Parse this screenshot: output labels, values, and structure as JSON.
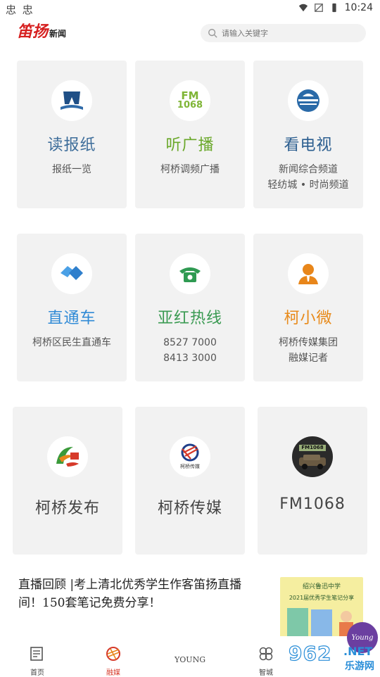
{
  "status_bar": {
    "left_icons": "忠 忠",
    "time": "10:24"
  },
  "header": {
    "logo_main": "笛扬",
    "logo_sub": "新闻",
    "search_placeholder": "请输入关键字"
  },
  "cards": [
    {
      "title": "读报纸",
      "desc": [
        "报纸一览"
      ],
      "title_color": "#3d6d9a",
      "icon": "newspaper-icon"
    },
    {
      "title": "听广播",
      "desc": [
        "柯桥调频广播"
      ],
      "title_color": "#6aa82a",
      "icon": "fm-radio-icon",
      "icon_text": [
        "FM",
        "1068"
      ]
    },
    {
      "title": "看电视",
      "desc": [
        "新闻综合频道",
        "轻纺城 • 时尚频道"
      ],
      "title_color": "#2a5d8f",
      "icon": "tv-station-icon"
    },
    {
      "title": "直通车",
      "desc": [
        "柯桥区民生直通车"
      ],
      "title_color": "#2f8ad6",
      "icon": "handshake-icon"
    },
    {
      "title": "亚红热线",
      "desc": [
        "8527 7000",
        "8413 3000"
      ],
      "title_color": "#3a9a52",
      "icon": "phone-icon"
    },
    {
      "title": "柯小微",
      "desc": [
        "柯桥传媒集团",
        "融媒记者"
      ],
      "title_color": "#e88a1a",
      "icon": "reporter-icon"
    }
  ],
  "media_cards": [
    {
      "title": "柯桥发布",
      "icon": "keqiao-release-logo-icon"
    },
    {
      "title": "柯桥传媒",
      "icon": "keqiao-media-logo-icon",
      "logo_caption": "柯桥传媒"
    },
    {
      "title": "FM1068",
      "icon": "fm1068-car-icon",
      "badge": "FM1068"
    }
  ],
  "news": {
    "headline": "直播回顾 |考上清北优秀学生作客笛扬直播间！150套笔记免费分享！",
    "thumb_line1": "绍兴鲁迅中学",
    "thumb_line2": "2021届优秀学生笔记分享"
  },
  "tabs": [
    {
      "label": "首页",
      "icon": "home-doc-icon"
    },
    {
      "label": "融媒",
      "icon": "media-fusion-icon",
      "active": true
    },
    {
      "label": "YOUNG",
      "icon": "young-icon",
      "badge": "Young"
    },
    {
      "label": "智城",
      "icon": "smart-city-icon"
    }
  ],
  "watermark": {
    "number": "962",
    "net": ".NET",
    "site": "乐游网"
  }
}
